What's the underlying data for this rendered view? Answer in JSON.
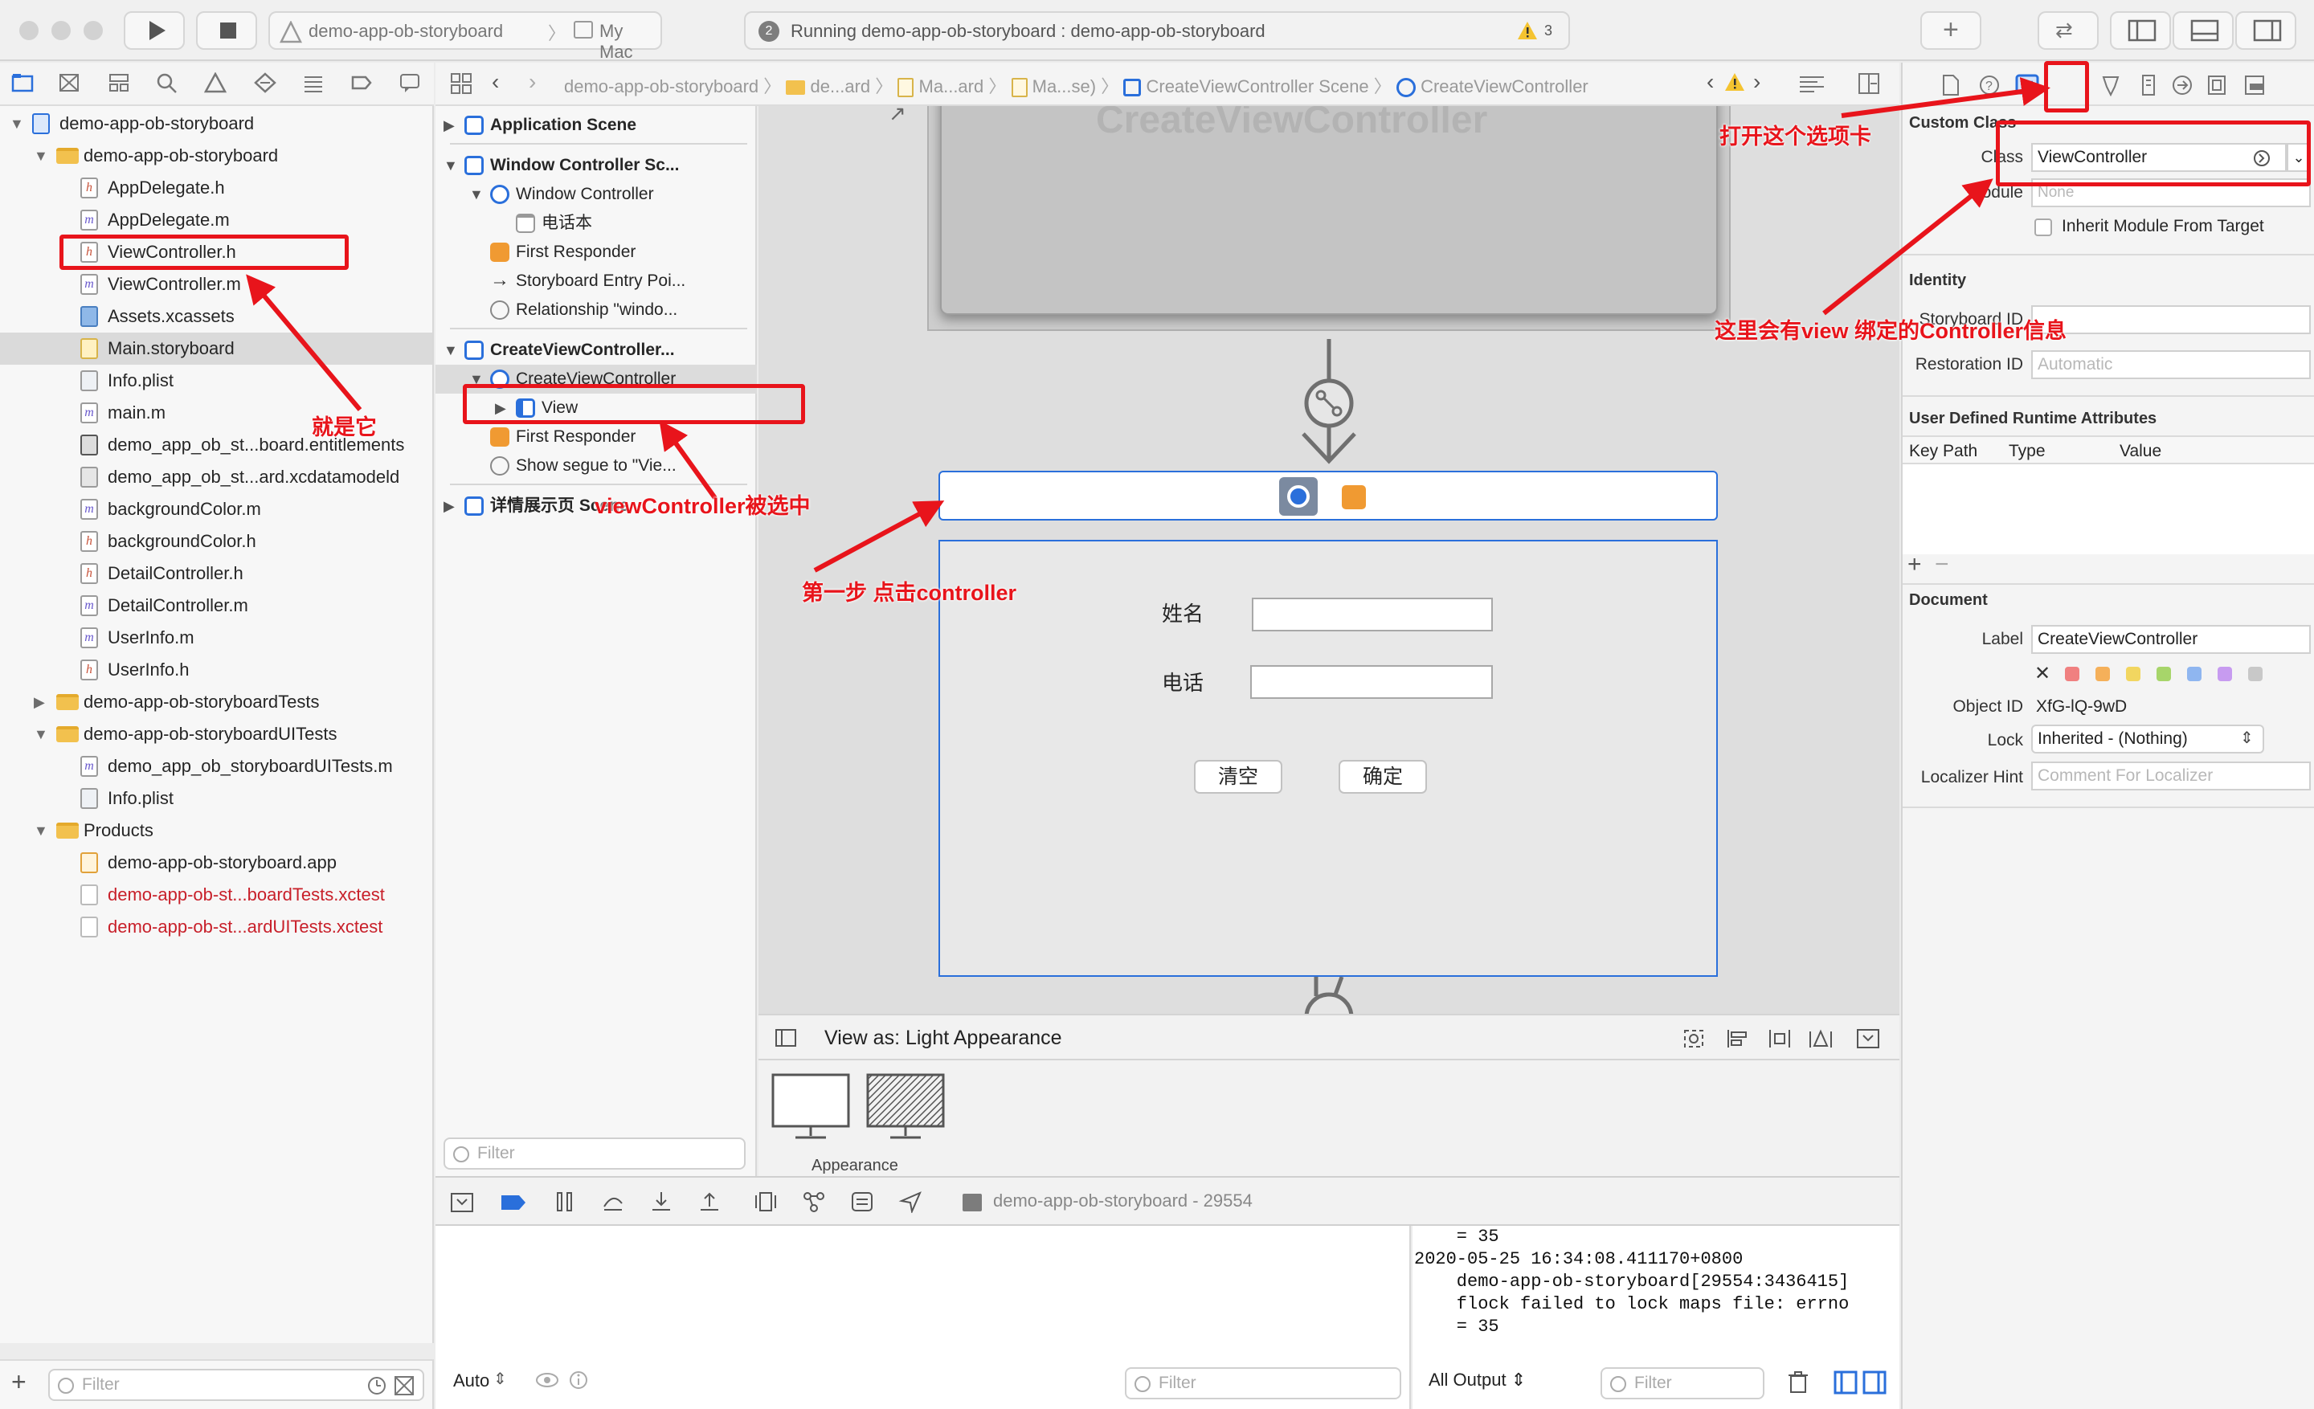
{
  "toolbar": {
    "scheme": "demo-app-ob-storyboard",
    "destination": "My Mac",
    "status": "Running demo-app-ob-storyboard : demo-app-ob-storyboard",
    "status_badge": "2",
    "warning_count": "3"
  },
  "navigator": {
    "items": [
      {
        "label": "demo-app-ob-storyboard",
        "kind": "project",
        "level": 0,
        "open": true
      },
      {
        "label": "demo-app-ob-storyboard",
        "kind": "folder",
        "level": 1,
        "open": true
      },
      {
        "label": "AppDelegate.h",
        "kind": "h",
        "level": 2
      },
      {
        "label": "AppDelegate.m",
        "kind": "m",
        "level": 2
      },
      {
        "label": "ViewController.h",
        "kind": "h",
        "level": 2
      },
      {
        "label": "ViewController.m",
        "kind": "m",
        "level": 2
      },
      {
        "label": "Assets.xcassets",
        "kind": "assets",
        "level": 2
      },
      {
        "label": "Main.storyboard",
        "kind": "storyboard",
        "level": 2,
        "selected": true
      },
      {
        "label": "Info.plist",
        "kind": "plist",
        "level": 2
      },
      {
        "label": "main.m",
        "kind": "m",
        "level": 2
      },
      {
        "label": "demo_app_ob_st...board.entitlements",
        "kind": "ent",
        "level": 2
      },
      {
        "label": "demo_app_ob_st...ard.xcdatamodeld",
        "kind": "model",
        "level": 2
      },
      {
        "label": "backgroundColor.m",
        "kind": "m",
        "level": 2
      },
      {
        "label": "backgroundColor.h",
        "kind": "h",
        "level": 2
      },
      {
        "label": "DetailController.h",
        "kind": "h",
        "level": 2
      },
      {
        "label": "DetailController.m",
        "kind": "m",
        "level": 2
      },
      {
        "label": "UserInfo.m",
        "kind": "m",
        "level": 2
      },
      {
        "label": "UserInfo.h",
        "kind": "h",
        "level": 2
      },
      {
        "label": "demo-app-ob-storyboardTests",
        "kind": "folder",
        "level": 1,
        "open": false
      },
      {
        "label": "demo-app-ob-storyboardUITests",
        "kind": "folder",
        "level": 1,
        "open": true
      },
      {
        "label": "demo_app_ob_storyboardUITests.m",
        "kind": "m",
        "level": 2
      },
      {
        "label": "Info.plist",
        "kind": "plist",
        "level": 2
      },
      {
        "label": "Products",
        "kind": "folder",
        "level": 1,
        "open": true
      },
      {
        "label": "demo-app-ob-storyboard.app",
        "kind": "app",
        "level": 2
      },
      {
        "label": "demo-app-ob-st...boardTests.xctest",
        "kind": "test",
        "level": 2,
        "red": true
      },
      {
        "label": "demo-app-ob-st...ardUITests.xctest",
        "kind": "test",
        "level": 2,
        "red": true
      }
    ],
    "filter_placeholder": "Filter"
  },
  "jumpbar": {
    "crumbs": [
      "demo-app-ob-storyboard",
      "de...ard",
      "Ma...ard",
      "Ma...se)",
      "CreateViewController Scene",
      "CreateViewController"
    ]
  },
  "outline": {
    "items": [
      {
        "label": "Application Scene",
        "kind": "scene",
        "level": 0,
        "bold": true,
        "disc": "closed"
      },
      {
        "label": "Window Controller Sc...",
        "kind": "scene",
        "level": 0,
        "bold": true,
        "disc": "open"
      },
      {
        "label": "Window Controller",
        "kind": "circle",
        "level": 1,
        "disc": "open"
      },
      {
        "label": "电话本",
        "kind": "window",
        "level": 2
      },
      {
        "label": "First Responder",
        "kind": "cube",
        "level": 1
      },
      {
        "label": "Storyboard Entry Poi...",
        "kind": "arrow",
        "level": 1
      },
      {
        "label": "Relationship \"windo...",
        "kind": "rel",
        "level": 1
      },
      {
        "label": "CreateViewController...",
        "kind": "scene",
        "level": 0,
        "bold": true,
        "disc": "open"
      },
      {
        "label": "CreateViewController",
        "kind": "circle",
        "level": 1,
        "disc": "open",
        "selected": true
      },
      {
        "label": "View",
        "kind": "view",
        "level": 2,
        "disc": "closed"
      },
      {
        "label": "First Responder",
        "kind": "cube",
        "level": 1
      },
      {
        "label": "Show segue to \"Vie...",
        "kind": "rel",
        "level": 1
      },
      {
        "label": "详情展示页 Scene",
        "kind": "scene",
        "level": 0,
        "bold": true,
        "disc": "closed"
      }
    ],
    "filter_placeholder": "Filter"
  },
  "canvas": {
    "ghost_title": "CreateViewController",
    "form": {
      "name_label": "姓名",
      "phone_label": "电话",
      "clear_button": "清空",
      "ok_button": "确定"
    },
    "view_as": "View as: Light Appearance",
    "appearance_label": "Appearance"
  },
  "debug": {
    "process": "demo-app-ob-storyboard - 29554",
    "auto_label": "Auto",
    "filter_placeholder": "Filter",
    "output_label": "All Output",
    "console_lines": [
      "    = 35",
      "2020-05-25 16:34:08.411170+0800",
      "    demo-app-ob-storyboard[29554:3436415]",
      "    flock failed to lock maps file: errno",
      "    = 35"
    ]
  },
  "inspector": {
    "custom_class_header": "Custom Class",
    "class_label": "Class",
    "class_value": "ViewController",
    "module_label": "Module",
    "module_value": "None",
    "inherit_label": "Inherit Module From Target",
    "identity_header": "Identity",
    "storyboard_id_label": "Storyboard ID",
    "restoration_id_label": "Restoration ID",
    "restoration_placeholder": "Automatic",
    "udra_header": "User Defined Runtime Attributes",
    "udra_columns": [
      "Key Path",
      "Type",
      "Value"
    ],
    "document_header": "Document",
    "label_label": "Label",
    "label_value": "CreateViewController",
    "object_id_label": "Object ID",
    "object_id_value": "XfG-lQ-9wD",
    "lock_label": "Lock",
    "lock_value": "Inherited - (Nothing)",
    "localizer_label": "Localizer Hint",
    "localizer_placeholder": "Comment For Localizer",
    "label_colors": [
      "#f08080",
      "#f5b05a",
      "#f2d660",
      "#a7d56a",
      "#8fb6f0",
      "#c79bf0",
      "#c8c8c8"
    ]
  },
  "annotations": {
    "it_is": "就是它",
    "vc_selected": "viewController被选中",
    "step1": "第一步 点击controller",
    "open_tab": "打开这个选项卡",
    "binding_info": "这里会有view 绑定的Controller信息"
  },
  "colors": {
    "annotation": "#e8141b",
    "accent": "#2a6fdb"
  }
}
